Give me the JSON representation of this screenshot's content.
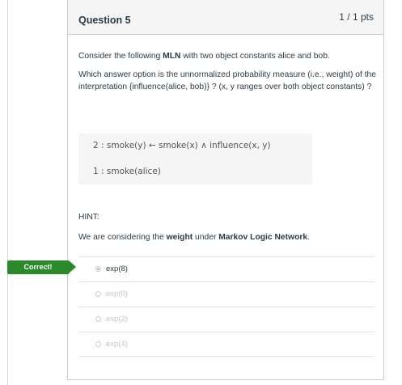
{
  "question": {
    "title": "Question 5",
    "points": "1 / 1 pts",
    "intro_pre": "Consider the following ",
    "intro_bold": "MLN",
    "intro_post": " with two object constants alice and bob.",
    "prompt": "Which answer option is the unnormalized probability measure (i.e., weight) of the interpretation {influence(alice, bob)} ? (x, y ranges over both object constants) ?",
    "formulas": [
      "2 : smoke(y) ← smoke(x) ∧ influence(x, y)",
      "1 : smoke(alice)"
    ],
    "hint_label": "HINT:",
    "hint_pre": "We are considering the ",
    "hint_bold1": "weight",
    "hint_mid": " under ",
    "hint_bold2": "Markov Logic Network",
    "hint_post": "."
  },
  "result_badge": "Correct!",
  "answers": [
    {
      "label": "exp(8)",
      "selected": true
    },
    {
      "label": "exp(0)",
      "selected": false
    },
    {
      "label": "exp(2)",
      "selected": false
    },
    {
      "label": "exp(4)",
      "selected": false
    }
  ],
  "colors": {
    "correct_green": "#2a8a2a",
    "header_bg": "#f5f5f5",
    "text": "#2d3b45"
  }
}
